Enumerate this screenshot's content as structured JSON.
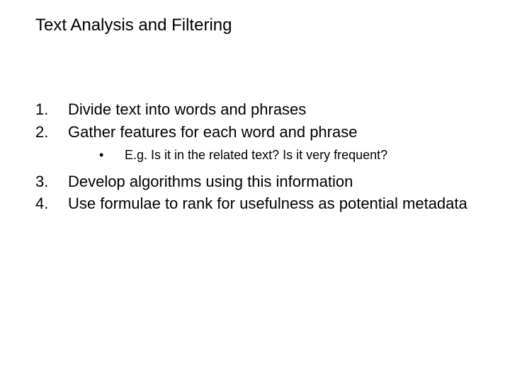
{
  "title": "Text Analysis and Filtering",
  "items": {
    "i1": {
      "num": "1.",
      "text": "Divide text into words and phrases"
    },
    "i2": {
      "num": "2.",
      "text": "Gather features for each word and phrase"
    },
    "sub": {
      "bullet": "•",
      "text": "E.g. Is it in the related text?  Is it very frequent?"
    },
    "i3": {
      "num": "3.",
      "text": "Develop algorithms using this information"
    },
    "i4": {
      "num": "4.",
      "text": "Use formulae to rank for usefulness as potential metadata"
    }
  }
}
